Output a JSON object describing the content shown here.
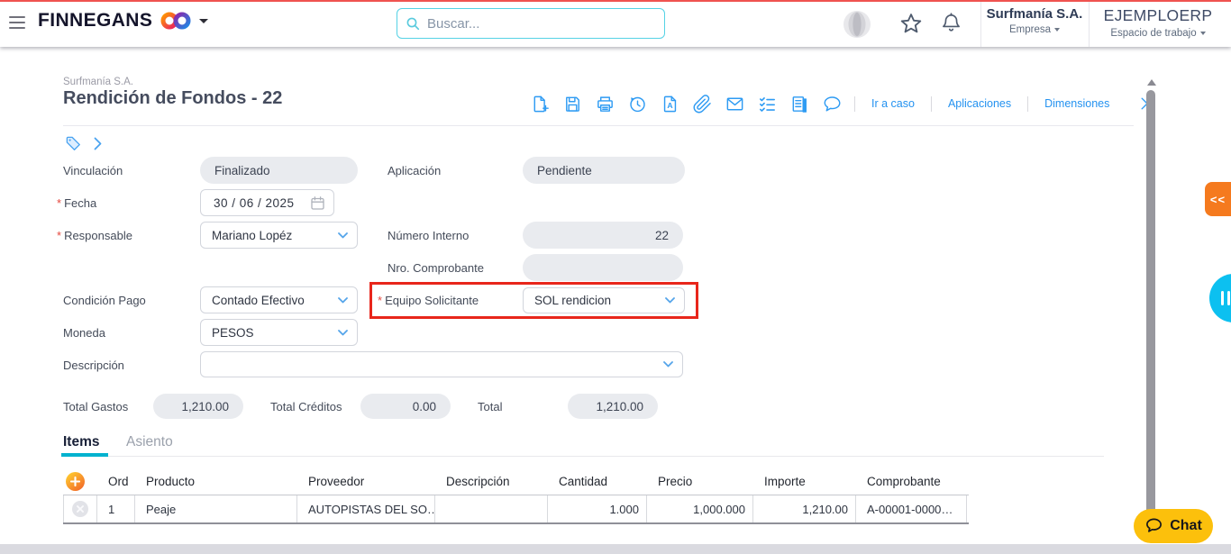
{
  "header": {
    "brand": "FINNEGANS",
    "search": {
      "placeholder": "Buscar..."
    },
    "company": {
      "name": "Surfmanía S.A.",
      "role_label": "Empresa"
    },
    "workspace": {
      "name": "EJEMPLOERP",
      "role_label": "Espacio de trabajo"
    },
    "icon_names": [
      "menu-icon",
      "brand-logo-infinity",
      "caret-down-icon",
      "search-icon",
      "assistant-sphere-icon",
      "star-icon",
      "bell-icon"
    ]
  },
  "document": {
    "company": "Surfmanía S.A.",
    "title": "Rendición de Fondos - 22",
    "toolbar": {
      "icon_names": [
        "new-document-icon",
        "save-icon",
        "print-icon",
        "history-icon",
        "export-document-icon",
        "attachment-icon",
        "email-icon",
        "checklist-icon",
        "journal-icon",
        "comment-icon",
        "close-icon"
      ],
      "links": [
        "Ir a caso",
        "Aplicaciones",
        "Dimensiones"
      ]
    }
  },
  "form": {
    "vinculacion": {
      "label": "Vinculación",
      "value": "Finalizado"
    },
    "aplicacion": {
      "label": "Aplicación",
      "value": "Pendiente"
    },
    "fecha": {
      "label": "Fecha",
      "required": "*",
      "value": "30 / 06 / 2025"
    },
    "responsable": {
      "label": "Responsable",
      "required": "*",
      "value": "Mariano Lopéz"
    },
    "numero_interno": {
      "label": "Número Interno",
      "value": "22"
    },
    "nro_comprobante": {
      "label": "Nro. Comprobante",
      "value": ""
    },
    "condicion_pago": {
      "label": "Condición Pago",
      "value": "Contado Efectivo"
    },
    "equipo_solicitante": {
      "label": "Equipo Solicitante",
      "required": "*",
      "value": "SOL rendicion",
      "highlighted": true
    },
    "moneda": {
      "label": "Moneda",
      "value": "PESOS"
    },
    "descripcion": {
      "label": "Descripción",
      "value": ""
    },
    "totales": {
      "total_gastos": {
        "label": "Total Gastos",
        "value": "1,210.00"
      },
      "total_creditos": {
        "label": "Total Créditos",
        "value": "0.00"
      },
      "total": {
        "label": "Total",
        "value": "1,210.00"
      }
    }
  },
  "tabs": {
    "items": "Items",
    "asiento": "Asiento",
    "active": "Items"
  },
  "items_table": {
    "columns": {
      "ord": "Ord",
      "producto": "Producto",
      "proveedor": "Proveedor",
      "descripcion": "Descripción",
      "cantidad": "Cantidad",
      "precio": "Precio",
      "importe": "Importe",
      "comprobante": "Comprobante"
    },
    "rows": [
      {
        "ord": "1",
        "producto": "Peaje",
        "proveedor": "AUTOPISTAS DEL SO…",
        "descripcion": "",
        "cantidad": "1.000",
        "precio": "1,000.000",
        "importe": "1,210.00",
        "comprobante": "A-00001-0000…"
      }
    ]
  },
  "side": {
    "collapse_label": "<<",
    "chat_label": "Chat"
  },
  "colors": {
    "accent_blue": "#2e9bf3",
    "highlight_red": "#e8261b",
    "tab_underline": "#00b2cf",
    "orange_tab": "#f57a1e",
    "cyan_handle": "#0cc0f0",
    "chat_yellow": "#fcc00c",
    "search_border": "#55d2e5",
    "top_accent": "#ef5350"
  }
}
